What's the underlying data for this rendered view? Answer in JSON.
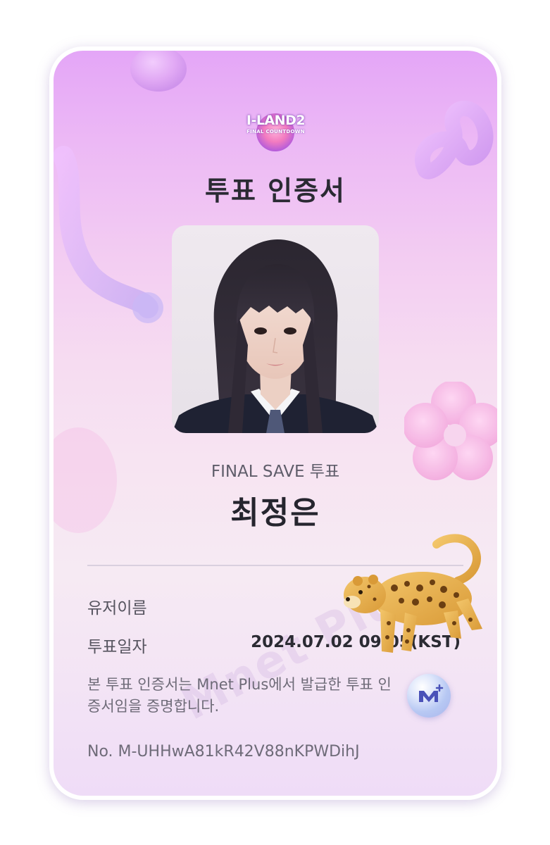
{
  "certificate": {
    "logo": {
      "main_text": "I-LAND2",
      "sub_text": "FINAL COUNTDOWN"
    },
    "title": "투표 인증서",
    "vote_type": "FINAL SAVE 투표",
    "candidate_name": "최정은",
    "rows": [
      {
        "label": "유저이름",
        "value": ""
      },
      {
        "label": "투표일자",
        "value": "2024.07.02 09:05(KST)"
      }
    ],
    "notice": "본 투표 인증서는 Mnet Plus에서 발급한 투표 인증서임을 증명합니다.",
    "serial": "No. M-UHHwA81kR42V88nKPWDihJ",
    "watermark": "Mnet Plus",
    "brand_badge_icon": "mnet-plus-icon"
  },
  "overlay": {
    "sticker_icon": "leopard-sticker-icon"
  },
  "colors": {
    "title": "#2a2a33",
    "gradient_top": "#e4a6f7",
    "gradient_bottom": "#efdcf7",
    "badge": "#b7c8f3"
  }
}
